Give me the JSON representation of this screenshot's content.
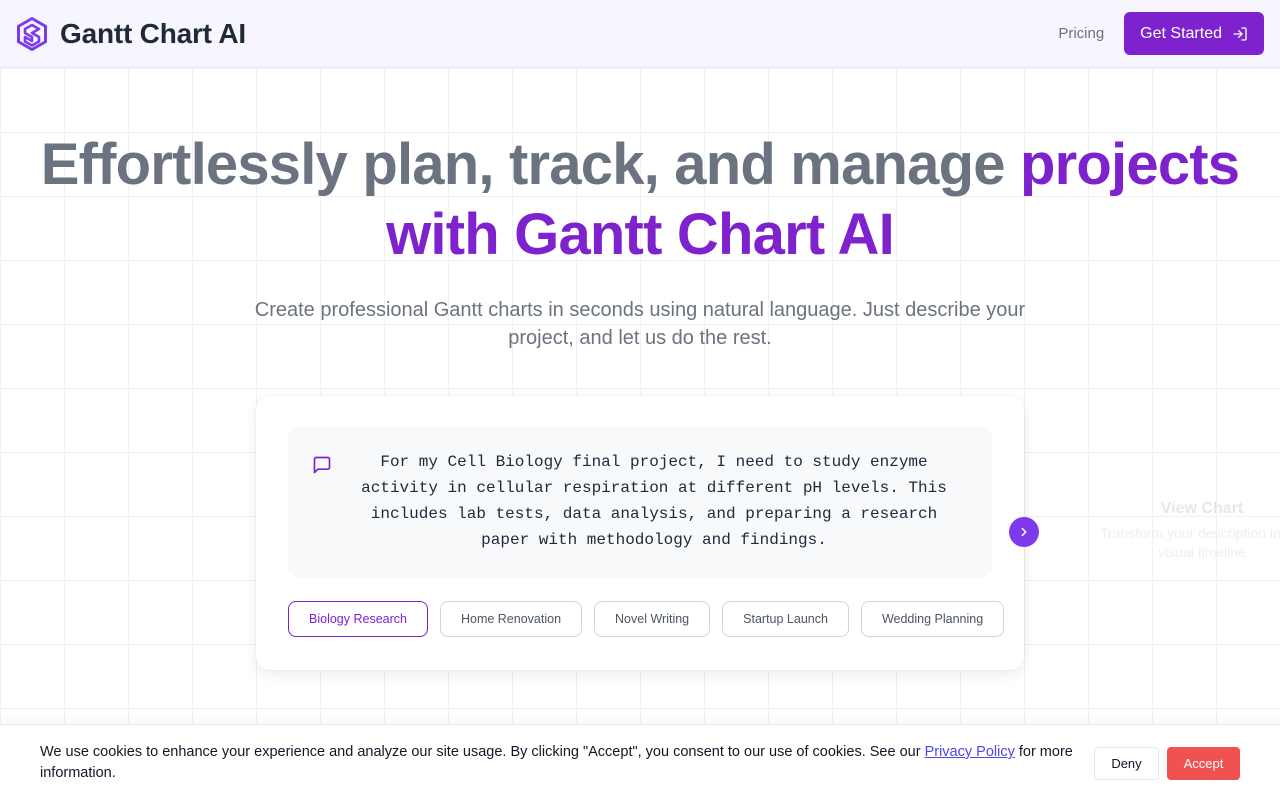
{
  "header": {
    "brand_name": "Gantt Chart AI",
    "pricing_label": "Pricing",
    "cta_label": "Get Started"
  },
  "hero": {
    "title_part1": "Effortlessly plan, track, and manage ",
    "title_highlight1": "projects",
    "title_highlight2": "with Gantt Chart AI",
    "subtitle": "Create professional Gantt charts in seconds using natural language. Just describe your project, and let us do the rest."
  },
  "prompt": {
    "text": "For my Cell Biology final project, I need to study enzyme activity in cellular respiration at different pH levels. This includes lab tests, data analysis, and preparing a research paper with methodology and findings."
  },
  "chips": [
    {
      "label": "Biology Research",
      "active": true
    },
    {
      "label": "Home Renovation",
      "active": false
    },
    {
      "label": "Novel Writing",
      "active": false
    },
    {
      "label": "Startup Launch",
      "active": false
    },
    {
      "label": "Wedding Planning",
      "active": false
    }
  ],
  "next_step": {
    "title": "View Chart",
    "description": "Transform your description into a visual timeline"
  },
  "cookie": {
    "text_before": "We use cookies to enhance your experience and analyze our site usage. By clicking \"Accept\", you consent to our use of cookies. See our ",
    "link_label": "Privacy Policy",
    "text_after": " for more information.",
    "deny_label": "Deny",
    "accept_label": "Accept"
  },
  "colors": {
    "accent": "#7e22ce",
    "accept": "#f05252"
  },
  "icons": {
    "logo": "hexagon-logo-icon",
    "cta": "login-arrow-icon",
    "prompt": "message-square-icon",
    "next": "chevron-right-icon"
  }
}
